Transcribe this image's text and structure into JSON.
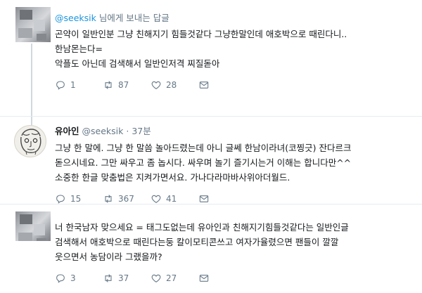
{
  "tweets": [
    {
      "reply_to_prefix": "",
      "reply_to_mention": "@seeksik",
      "reply_to_suffix": " 님에게 보내는 답글",
      "lines": [
        "곤약이 일반인분 그냥 친해지기 힘들것같다 그냥한말인데 애호박으로 때린다니..",
        "한남몬는다=",
        "악플도 아닌데 검색해서 일반인저격 찌질돋아"
      ],
      "replies": "1",
      "retweets": "87",
      "likes": "28"
    },
    {
      "name": "유아인",
      "handle": "@seeksik",
      "sep": "·",
      "time": "37분",
      "lines": [
        "그냥 한 말에. 그냥 한 말씀 놀아드렸는데 아니 글쎄 한남이라녀(코찡긋) 잔다르크",
        "돋으시네요. 그만 싸우고 좀 놉시다. 싸우며 놀기 즐기시는거 이해는 합니다만^^",
        "소중한 한글 맞춤법은 지켜가면서요. 가나다라마바사위아더월드."
      ],
      "replies": "15",
      "retweets": "367",
      "likes": "41"
    },
    {
      "lines": [
        "너 한국남자 맞으세요 = 태그도없는데 유아인과 친해지기힘들것같다는 일반인글",
        "검색해서 애호박으로 때린다는둥 칼이모티콘쓰고 여자가율렸으면 팬들이 깔깔",
        "웃으면서 농담이라 그랬을까?"
      ],
      "replies": "3",
      "retweets": "37",
      "likes": "27"
    }
  ],
  "icons": {
    "reply": "reply-icon",
    "retweet": "retweet-icon",
    "like": "heart-icon",
    "dm": "mail-icon"
  },
  "colors": {
    "link": "#1b95e0",
    "secondary": "#657786",
    "text": "#14171a",
    "divider": "#e6ecf0"
  }
}
